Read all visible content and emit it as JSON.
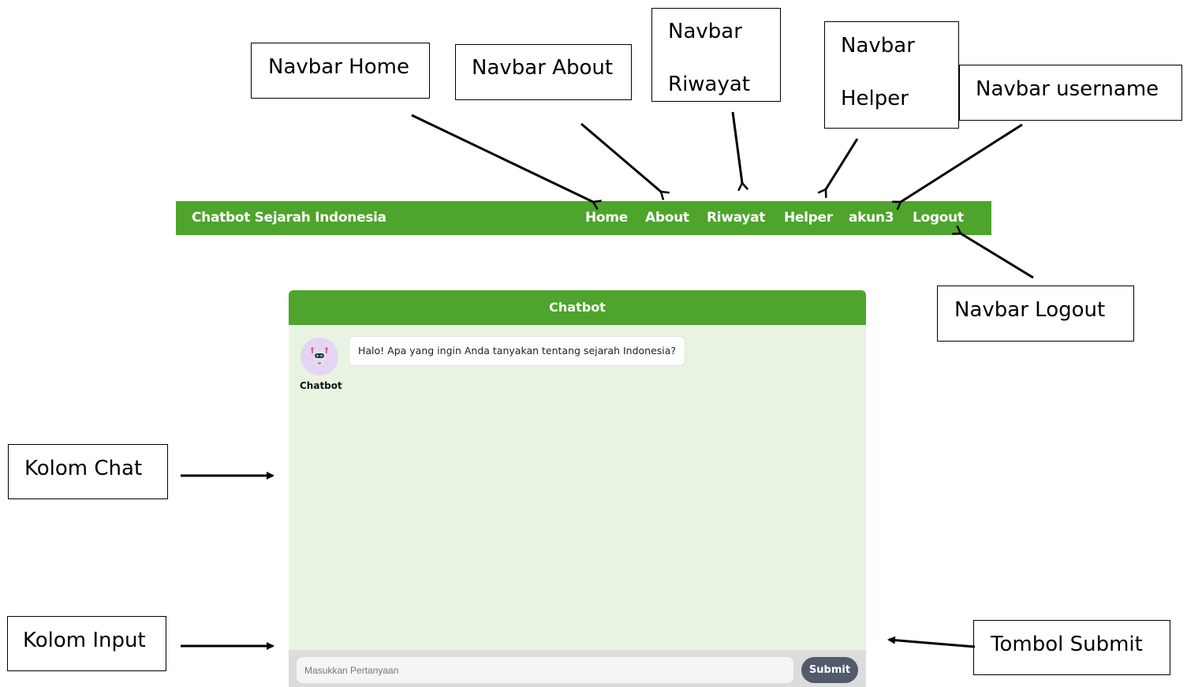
{
  "annotations": {
    "navbar_home": "Navbar Home",
    "navbar_about": "Navbar About",
    "navbar_riwayat_1": "Navbar",
    "navbar_riwayat_2": "Riwayat",
    "navbar_helper_1": "Navbar",
    "navbar_helper_2": "Helper",
    "navbar_username": "Navbar username",
    "navbar_logout": "Navbar Logout",
    "kolom_chat": "Kolom Chat",
    "kolom_input": "Kolom Input",
    "tombol_submit": "Tombol Submit"
  },
  "navbar": {
    "brand": "Chatbot Sejarah Indonesia",
    "links": {
      "home": "Home",
      "about": "About",
      "riwayat": "Riwayat",
      "helper": "Helper",
      "username": "akun3",
      "logout": "Logout"
    }
  },
  "chat": {
    "title": "Chatbot",
    "messages": [
      {
        "sender": "Chatbot",
        "text": "Halo! Apa yang ingin Anda tanyakan tentang sejarah Indonesia?"
      }
    ],
    "input_placeholder": "Masukkan Pertanyaan",
    "submit_label": "Submit"
  },
  "colors": {
    "brand_green": "#4ea42c",
    "chat_background": "#e8f4e2",
    "submit_button": "#525a6b"
  },
  "icons": {
    "avatar": "robot-icon"
  }
}
